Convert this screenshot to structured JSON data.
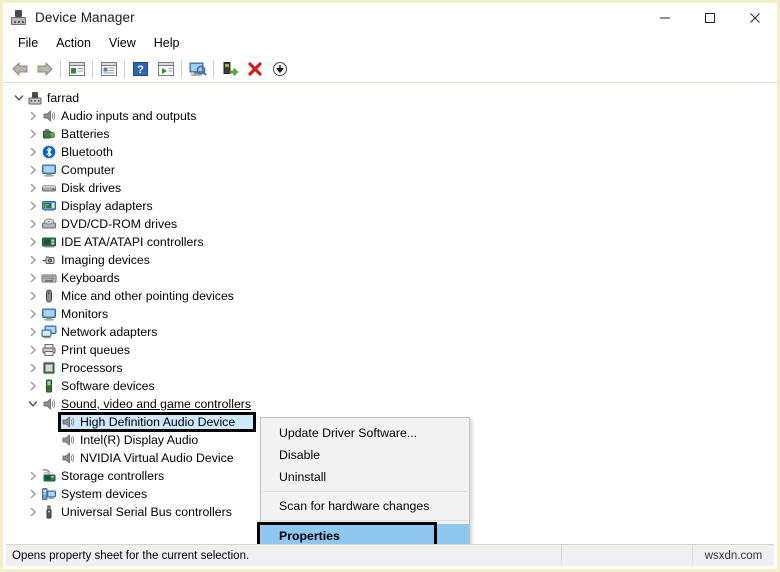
{
  "window": {
    "title": "Device Manager",
    "icon": "device-manager-icon",
    "caption_buttons": [
      {
        "name": "minimize",
        "glyph": "minimize-icon"
      },
      {
        "name": "maximize",
        "glyph": "maximize-icon"
      },
      {
        "name": "close",
        "glyph": "close-icon"
      }
    ]
  },
  "menubar": {
    "items": [
      {
        "label": "File"
      },
      {
        "label": "Action"
      },
      {
        "label": "View"
      },
      {
        "label": "Help"
      }
    ]
  },
  "toolbar": {
    "buttons": [
      {
        "name": "back-button",
        "icon": "back-arrow-icon"
      },
      {
        "name": "forward-button",
        "icon": "forward-arrow-icon"
      },
      {
        "name": "show-hide-console-tree-button",
        "icon": "console-tree-icon"
      },
      {
        "name": "properties-button",
        "icon": "properties-window-icon"
      },
      {
        "name": "help-button",
        "icon": "question-mark-icon"
      },
      {
        "name": "scan-button",
        "icon": "play-window-icon"
      },
      {
        "name": "scan-for-hardware-changes-button",
        "icon": "monitor-scan-icon"
      },
      {
        "name": "update-driver-button",
        "icon": "update-driver-icon"
      },
      {
        "name": "uninstall-button",
        "icon": "red-x-icon"
      },
      {
        "name": "disable-button",
        "icon": "down-arrow-circle-icon"
      }
    ]
  },
  "tree": {
    "items": [
      {
        "level": 0,
        "label": "farrad",
        "icon": "computer-node-icon",
        "expander": "expanded",
        "selected": false,
        "underline": false
      },
      {
        "level": 1,
        "label": "Audio inputs and outputs",
        "icon": "speaker-icon",
        "expander": "collapsed",
        "selected": false,
        "underline": false
      },
      {
        "level": 1,
        "label": "Batteries",
        "icon": "battery-icon",
        "expander": "collapsed",
        "selected": false,
        "underline": false
      },
      {
        "level": 1,
        "label": "Bluetooth",
        "icon": "bluetooth-icon",
        "expander": "collapsed",
        "selected": false,
        "underline": false
      },
      {
        "level": 1,
        "label": "Computer",
        "icon": "monitor-icon",
        "expander": "collapsed",
        "selected": false,
        "underline": false
      },
      {
        "level": 1,
        "label": "Disk drives",
        "icon": "disk-drive-icon",
        "expander": "collapsed",
        "selected": false,
        "underline": false
      },
      {
        "level": 1,
        "label": "Display adapters",
        "icon": "display-adapter-icon",
        "expander": "collapsed",
        "selected": false,
        "underline": false
      },
      {
        "level": 1,
        "label": "DVD/CD-ROM drives",
        "icon": "dvd-drive-icon",
        "expander": "collapsed",
        "selected": false,
        "underline": false
      },
      {
        "level": 1,
        "label": "IDE ATA/ATAPI controllers",
        "icon": "ide-controller-icon",
        "expander": "collapsed",
        "selected": false,
        "underline": false
      },
      {
        "level": 1,
        "label": "Imaging devices",
        "icon": "camera-icon",
        "expander": "collapsed",
        "selected": false,
        "underline": false
      },
      {
        "level": 1,
        "label": "Keyboards",
        "icon": "keyboard-icon",
        "expander": "collapsed",
        "selected": false,
        "underline": false
      },
      {
        "level": 1,
        "label": "Mice and other pointing devices",
        "icon": "mouse-icon",
        "expander": "collapsed",
        "selected": false,
        "underline": false
      },
      {
        "level": 1,
        "label": "Monitors",
        "icon": "monitor-icon",
        "expander": "collapsed",
        "selected": false,
        "underline": false
      },
      {
        "level": 1,
        "label": "Network adapters",
        "icon": "network-adapter-icon",
        "expander": "collapsed",
        "selected": false,
        "underline": false
      },
      {
        "level": 1,
        "label": "Print queues",
        "icon": "printer-icon",
        "expander": "collapsed",
        "selected": false,
        "underline": false
      },
      {
        "level": 1,
        "label": "Processors",
        "icon": "processor-icon",
        "expander": "collapsed",
        "selected": false,
        "underline": false
      },
      {
        "level": 1,
        "label": "Software devices",
        "icon": "software-device-icon",
        "expander": "collapsed",
        "selected": false,
        "underline": false
      },
      {
        "level": 1,
        "label": "Sound, video and game controllers",
        "icon": "speaker-icon",
        "expander": "expanded",
        "selected": false,
        "underline": true
      },
      {
        "level": 2,
        "label": "High Definition Audio Device",
        "icon": "speaker-icon",
        "expander": "none",
        "selected": true,
        "underline": false
      },
      {
        "level": 2,
        "label": "Intel(R) Display Audio",
        "icon": "speaker-icon",
        "expander": "none",
        "selected": false,
        "underline": false
      },
      {
        "level": 2,
        "label": "NVIDIA Virtual Audio Device",
        "icon": "speaker-icon",
        "expander": "none",
        "selected": false,
        "underline": false
      },
      {
        "level": 1,
        "label": "Storage controllers",
        "icon": "storage-controller-icon",
        "expander": "collapsed",
        "selected": false,
        "underline": false
      },
      {
        "level": 1,
        "label": "System devices",
        "icon": "system-device-icon",
        "expander": "collapsed",
        "selected": false,
        "underline": false
      },
      {
        "level": 1,
        "label": "Universal Serial Bus controllers",
        "icon": "usb-icon",
        "expander": "collapsed",
        "selected": false,
        "underline": false
      }
    ]
  },
  "context_menu": {
    "items": [
      {
        "label": "Update Driver Software...",
        "type": "item",
        "highlighted": false
      },
      {
        "label": "Disable",
        "type": "item",
        "highlighted": false
      },
      {
        "label": "Uninstall",
        "type": "item",
        "highlighted": false
      },
      {
        "label": "",
        "type": "separator",
        "highlighted": false
      },
      {
        "label": "Scan for hardware changes",
        "type": "item",
        "highlighted": false
      },
      {
        "label": "",
        "type": "separator",
        "highlighted": false
      },
      {
        "label": "Properties",
        "type": "item",
        "highlighted": true
      }
    ]
  },
  "statusbar": {
    "message": "Opens property sheet for the current selection.",
    "pane2": "",
    "watermark": "wsxdn.com"
  },
  "colors": {
    "window_border": "#f2eec8",
    "selection_blue": "#cde8ff",
    "menu_highlight": "#8ec8f0",
    "annotation_black": "#000000",
    "statusbar_bg": "#f0f0f0"
  }
}
